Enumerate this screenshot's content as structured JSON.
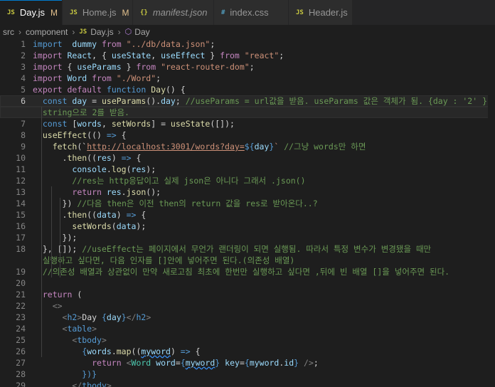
{
  "tabs": [
    {
      "name": "Day.js",
      "icon": "JS",
      "modified": "M",
      "active": true,
      "italic": false
    },
    {
      "name": "Home.js",
      "icon": "JS",
      "modified": "M",
      "active": false,
      "italic": false
    },
    {
      "name": "manifest.json",
      "icon": "{}",
      "modified": "",
      "active": false,
      "italic": true
    },
    {
      "name": "index.css",
      "icon": "#",
      "modified": "",
      "active": false,
      "italic": false
    },
    {
      "name": "Header.js",
      "icon": "JS",
      "modified": "",
      "active": false,
      "italic": false
    }
  ],
  "breadcrumb": {
    "folder1": "src",
    "folder2": "component",
    "file": "Day.js",
    "file_icon": "JS",
    "symbol": "Day"
  },
  "colors": {
    "accent": "#007acc",
    "js_icon": "#cbcb41",
    "json_icon": "#cbcb41",
    "css_icon": "#519aba",
    "symbol_icon": "#b180d7"
  },
  "lines": [
    {
      "n": "1",
      "t": [
        [
          "kw",
          "import"
        ],
        [
          "",
          "  "
        ],
        [
          "var",
          "dummy"
        ],
        [
          "",
          " "
        ],
        [
          "ctl",
          "from"
        ],
        [
          "",
          " "
        ],
        [
          "str",
          "\"../db/data.json\""
        ],
        [
          "",
          ";"
        ]
      ]
    },
    {
      "n": "2",
      "t": [
        [
          "ctl",
          "import"
        ],
        [
          "",
          " "
        ],
        [
          "var",
          "React"
        ],
        [
          "",
          ", { "
        ],
        [
          "var",
          "useState"
        ],
        [
          "",
          ", "
        ],
        [
          "var",
          "useEffect"
        ],
        [
          "",
          " } "
        ],
        [
          "ctl",
          "from"
        ],
        [
          "",
          " "
        ],
        [
          "str",
          "\"react\""
        ],
        [
          "",
          ";"
        ]
      ]
    },
    {
      "n": "3",
      "t": [
        [
          "ctl",
          "import"
        ],
        [
          "",
          ""
        ],
        [
          "",
          " { "
        ],
        [
          "var",
          "useParams"
        ],
        [
          "",
          " } "
        ],
        [
          "ctl",
          "from"
        ],
        [
          "",
          " "
        ],
        [
          "str",
          "\"react-router-dom\""
        ],
        [
          "",
          ";"
        ]
      ]
    },
    {
      "n": "4",
      "t": [
        [
          "ctl",
          "import"
        ],
        [
          "",
          " "
        ],
        [
          "var",
          "Word"
        ],
        [
          "",
          " "
        ],
        [
          "ctl",
          "from"
        ],
        [
          "",
          " "
        ],
        [
          "str",
          "\"./Word\""
        ],
        [
          "",
          ";"
        ]
      ]
    },
    {
      "n": "5",
      "t": [
        [
          "ctl",
          "export"
        ],
        [
          "",
          " "
        ],
        [
          "ctl",
          "default"
        ],
        [
          "",
          " "
        ],
        [
          "kw",
          "function"
        ],
        [
          "",
          " "
        ],
        [
          "fnc",
          "Day"
        ],
        [
          "",
          "() {"
        ]
      ]
    },
    {
      "n": "6",
      "cur": true,
      "t": [
        [
          "",
          "  "
        ],
        [
          "kw",
          "const"
        ],
        [
          "",
          " "
        ],
        [
          "var",
          "day"
        ],
        [
          "",
          " = "
        ],
        [
          "fnc",
          "useParams"
        ],
        [
          "",
          "()."
        ],
        [
          "var",
          "day"
        ],
        [
          "",
          "; "
        ],
        [
          "cm",
          "//useParams = url값을 받음. useParams 값은 객체가 됨. {day : '2' }"
        ]
      ]
    },
    {
      "n": "",
      "cur": true,
      "t": [
        [
          "cm",
          "  string으로 2를 받음."
        ]
      ]
    },
    {
      "n": "7",
      "t": [
        [
          "",
          "  "
        ],
        [
          "kw",
          "const"
        ],
        [
          "",
          " ["
        ],
        [
          "var",
          "words"
        ],
        [
          "",
          ", "
        ],
        [
          "fnc",
          "setWords"
        ],
        [
          "",
          "] = "
        ],
        [
          "fnc",
          "useState"
        ],
        [
          "",
          "([]);"
        ]
      ]
    },
    {
      "n": "8",
      "t": [
        [
          "",
          "  "
        ],
        [
          "fnc",
          "useEffect"
        ],
        [
          "",
          "(() "
        ],
        [
          "kw",
          "=>"
        ],
        [
          "",
          " {"
        ]
      ]
    },
    {
      "n": "9",
      "t": [
        [
          "",
          "    "
        ],
        [
          "fnc",
          "fetch"
        ],
        [
          "",
          "(`"
        ],
        [
          "str url",
          "http://localhost:3001/words?day="
        ],
        [
          "kw",
          "${"
        ],
        [
          "var",
          "day"
        ],
        [
          "kw",
          "}"
        ],
        [
          "str",
          "`"
        ],
        [
          "",
          " "
        ],
        [
          "cm",
          "//그냥 words만 하면"
        ]
      ]
    },
    {
      "n": "10",
      "t": [
        [
          "",
          "      ."
        ],
        [
          "fnc",
          "then"
        ],
        [
          "",
          "(("
        ],
        [
          "var",
          "res"
        ],
        [
          "",
          ") "
        ],
        [
          "kw",
          "=>"
        ],
        [
          "",
          " {"
        ]
      ]
    },
    {
      "n": "11",
      "t": [
        [
          "",
          "        "
        ],
        [
          "var",
          "console"
        ],
        [
          "",
          "."
        ],
        [
          "fnc",
          "log"
        ],
        [
          "",
          "("
        ],
        [
          "var",
          "res"
        ],
        [
          "",
          ");"
        ]
      ]
    },
    {
      "n": "12",
      "t": [
        [
          "",
          "        "
        ],
        [
          "cm",
          "//res는 http응답이고 실제 json은 아니다 그래서 .json()"
        ]
      ]
    },
    {
      "n": "13",
      "t": [
        [
          "",
          "        "
        ],
        [
          "ctl",
          "return"
        ],
        [
          "",
          " "
        ],
        [
          "var",
          "res"
        ],
        [
          "",
          "."
        ],
        [
          "fnc",
          "json"
        ],
        [
          "",
          "();"
        ]
      ]
    },
    {
      "n": "14",
      "t": [
        [
          "",
          "      }) "
        ],
        [
          "cm",
          "//다음 then은 이전 then의 return 값을 res로 받아온다..?"
        ]
      ]
    },
    {
      "n": "15",
      "t": [
        [
          "",
          "      ."
        ],
        [
          "fnc",
          "then"
        ],
        [
          "",
          "(("
        ],
        [
          "var",
          "data"
        ],
        [
          "",
          ") "
        ],
        [
          "kw",
          "=>"
        ],
        [
          "",
          " {"
        ]
      ]
    },
    {
      "n": "16",
      "t": [
        [
          "",
          "        "
        ],
        [
          "fnc",
          "setWords"
        ],
        [
          "",
          "("
        ],
        [
          "var",
          "data"
        ],
        [
          "",
          ");"
        ]
      ]
    },
    {
      "n": "17",
      "t": [
        [
          "",
          "      });"
        ]
      ]
    },
    {
      "n": "18",
      "t": [
        [
          "",
          "  }, []); "
        ],
        [
          "cm",
          "//useEffect는 페이지에서 무언가 랜더링이 되면 실행됨. 따라서 특정 변수가 변경됐을 때만"
        ]
      ]
    },
    {
      "n": "",
      "t": [
        [
          "cm",
          "  실행하고 싶다면, 다음 인자를 []안에 넣어주면 된다.(의존성 배열)"
        ]
      ]
    },
    {
      "n": "19",
      "t": [
        [
          "",
          "  "
        ],
        [
          "cm",
          "//의존성 배열과 상관없이 만약 새로고침 최초에 한번만 실행하고 싶다면 ,뒤에 빈 배열 []을 넣어주면 된다."
        ]
      ]
    },
    {
      "n": "20",
      "t": []
    },
    {
      "n": "21",
      "t": [
        [
          "",
          "  "
        ],
        [
          "ctl",
          "return"
        ],
        [
          "",
          " ("
        ]
      ]
    },
    {
      "n": "22",
      "t": [
        [
          "",
          "    "
        ],
        [
          "pun",
          "<>"
        ]
      ]
    },
    {
      "n": "23",
      "t": [
        [
          "",
          "      "
        ],
        [
          "pun",
          "<"
        ],
        [
          "tag",
          "h2"
        ],
        [
          "pun",
          ">"
        ],
        [
          "",
          "Day "
        ],
        [
          "kw",
          "{"
        ],
        [
          "var",
          "day"
        ],
        [
          "kw",
          "}"
        ],
        [
          "pun",
          "</"
        ],
        [
          "tag",
          "h2"
        ],
        [
          "pun",
          ">"
        ]
      ]
    },
    {
      "n": "24",
      "t": [
        [
          "",
          "      "
        ],
        [
          "pun",
          "<"
        ],
        [
          "tag",
          "table"
        ],
        [
          "pun",
          ">"
        ]
      ]
    },
    {
      "n": "25",
      "t": [
        [
          "",
          "        "
        ],
        [
          "pun",
          "<"
        ],
        [
          "tag",
          "tbody"
        ],
        [
          "pun",
          ">"
        ]
      ]
    },
    {
      "n": "26",
      "t": [
        [
          "",
          "          "
        ],
        [
          "kw",
          "{"
        ],
        [
          "var",
          "words"
        ],
        [
          "",
          "."
        ],
        [
          "fnc",
          "map"
        ],
        [
          "",
          "(("
        ],
        [
          "var wavy",
          "myword"
        ],
        [
          "",
          ") "
        ],
        [
          "kw",
          "=>"
        ],
        [
          "",
          " {"
        ]
      ]
    },
    {
      "n": "27",
      "t": [
        [
          "",
          "            "
        ],
        [
          "ctl",
          "return"
        ],
        [
          "",
          " "
        ],
        [
          "pun",
          "<"
        ],
        [
          "cls",
          "Word"
        ],
        [
          "",
          " "
        ],
        [
          "var",
          "word"
        ],
        [
          "",
          "="
        ],
        [
          "kw",
          "{"
        ],
        [
          "var wavy",
          "myword"
        ],
        [
          "kw",
          "}"
        ],
        [
          "",
          " "
        ],
        [
          "var",
          "key"
        ],
        [
          "",
          "="
        ],
        [
          "kw",
          "{"
        ],
        [
          "var",
          "myword"
        ],
        [
          "",
          "."
        ],
        [
          "var",
          "id"
        ],
        [
          "kw",
          "}"
        ],
        [
          "",
          " "
        ],
        [
          "pun",
          "/>"
        ],
        [
          "",
          ";"
        ]
      ]
    },
    {
      "n": "28",
      "t": [
        [
          "",
          "          "
        ],
        [
          "kw",
          "})"
        ],
        [
          "kw",
          "}"
        ]
      ]
    },
    {
      "n": "29",
      "t": [
        [
          "",
          "        "
        ],
        [
          "pun",
          "</"
        ],
        [
          "tag",
          "tbody"
        ],
        [
          "pun",
          ">"
        ]
      ]
    }
  ]
}
